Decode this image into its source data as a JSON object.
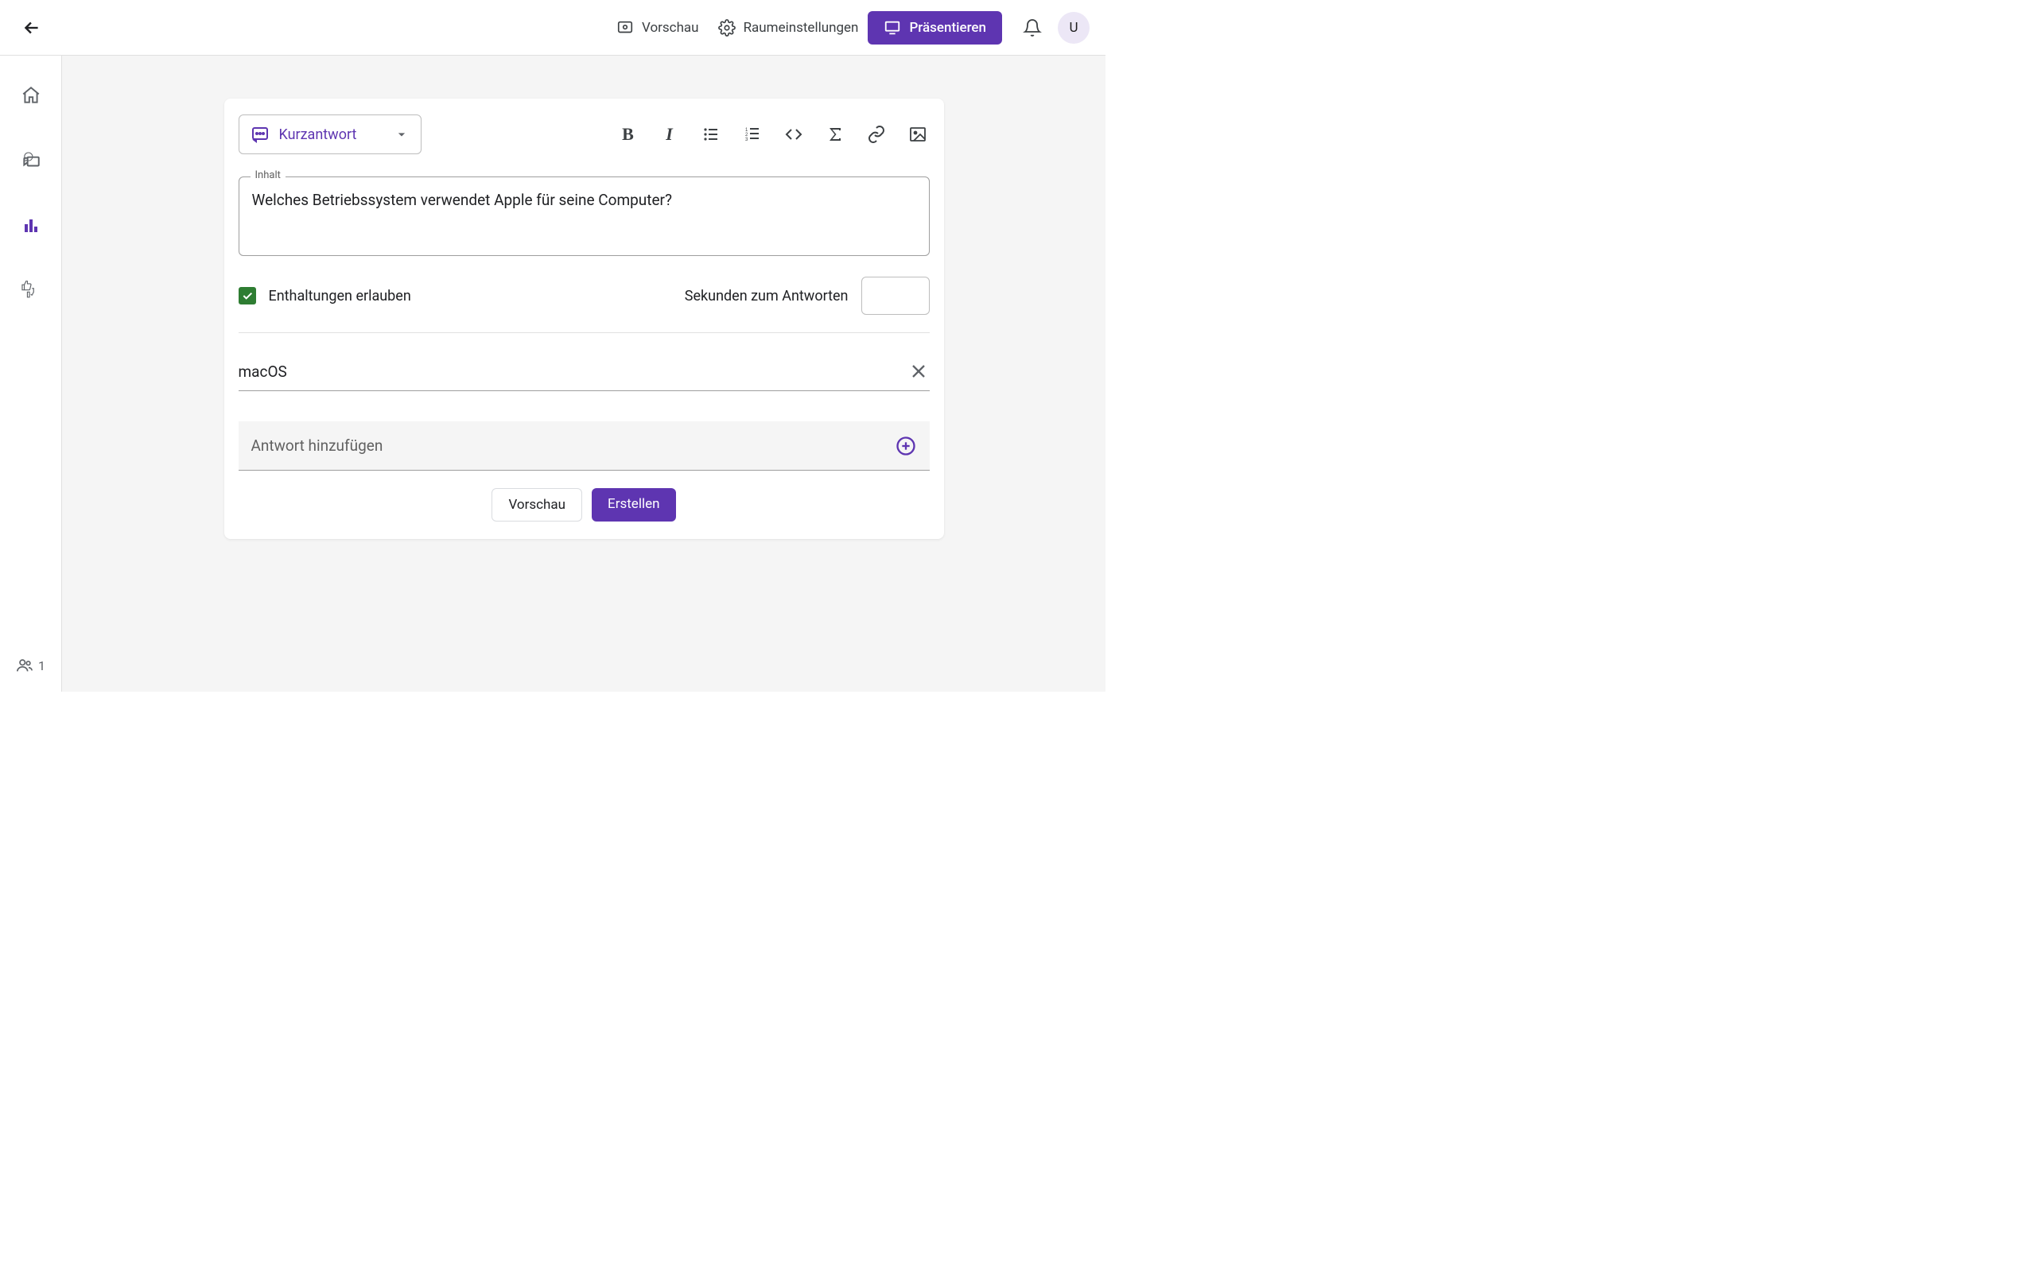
{
  "header": {
    "preview_label": "Vorschau",
    "settings_label": "Raumeinstellungen",
    "present_label": "Präsentieren",
    "avatar_initial": "U"
  },
  "sidebar": {
    "participants_count": "1"
  },
  "editor": {
    "type_selector_label": "Kurzantwort",
    "content_legend": "Inhalt",
    "content_text": "Welches Betriebssystem verwendet Apple für seine Computer?",
    "allow_abstain_label": "Enthaltungen erlauben",
    "allow_abstain_checked": true,
    "seconds_label": "Sekunden zum Antworten",
    "seconds_value": "",
    "answers": [
      {
        "text": "macOS"
      }
    ],
    "add_answer_placeholder": "Antwort hinzufügen",
    "preview_button": "Vorschau",
    "create_button": "Erstellen"
  }
}
